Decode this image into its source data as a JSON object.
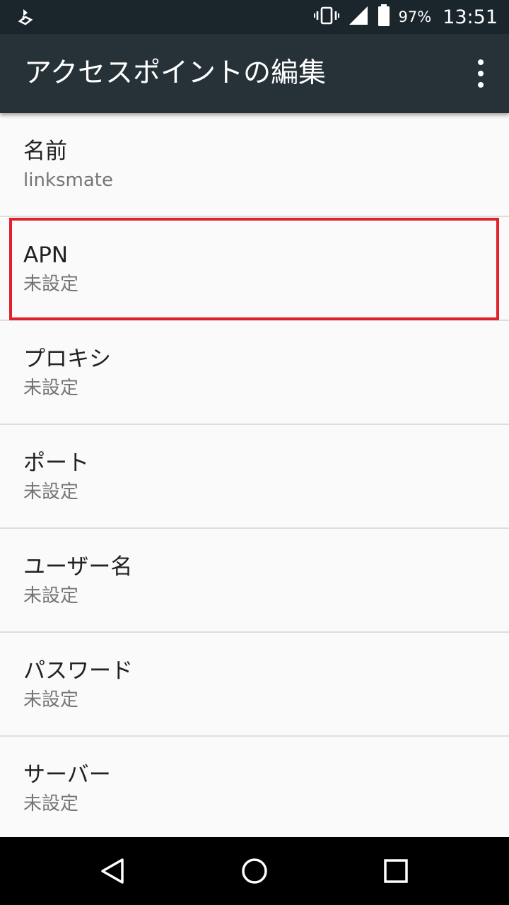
{
  "status_bar": {
    "battery_percent": "97%",
    "time": "13:51",
    "icons": [
      "notification-icon",
      "vibrate-icon",
      "signal-icon",
      "battery-icon"
    ]
  },
  "app_bar": {
    "title": "アクセスポイントの編集",
    "overflow_icon": "more-vert-icon"
  },
  "items": [
    {
      "title": "名前",
      "value": "linksmate"
    },
    {
      "title": "APN",
      "value": "未設定"
    },
    {
      "title": "プロキシ",
      "value": "未設定"
    },
    {
      "title": "ポート",
      "value": "未設定"
    },
    {
      "title": "ユーザー名",
      "value": "未設定"
    },
    {
      "title": "パスワード",
      "value": "未設定"
    },
    {
      "title": "サーバー",
      "value": "未設定"
    }
  ],
  "highlight_color": "#e0202a",
  "nav_bar": {
    "icons": [
      "back-icon",
      "home-icon",
      "recents-icon"
    ]
  }
}
